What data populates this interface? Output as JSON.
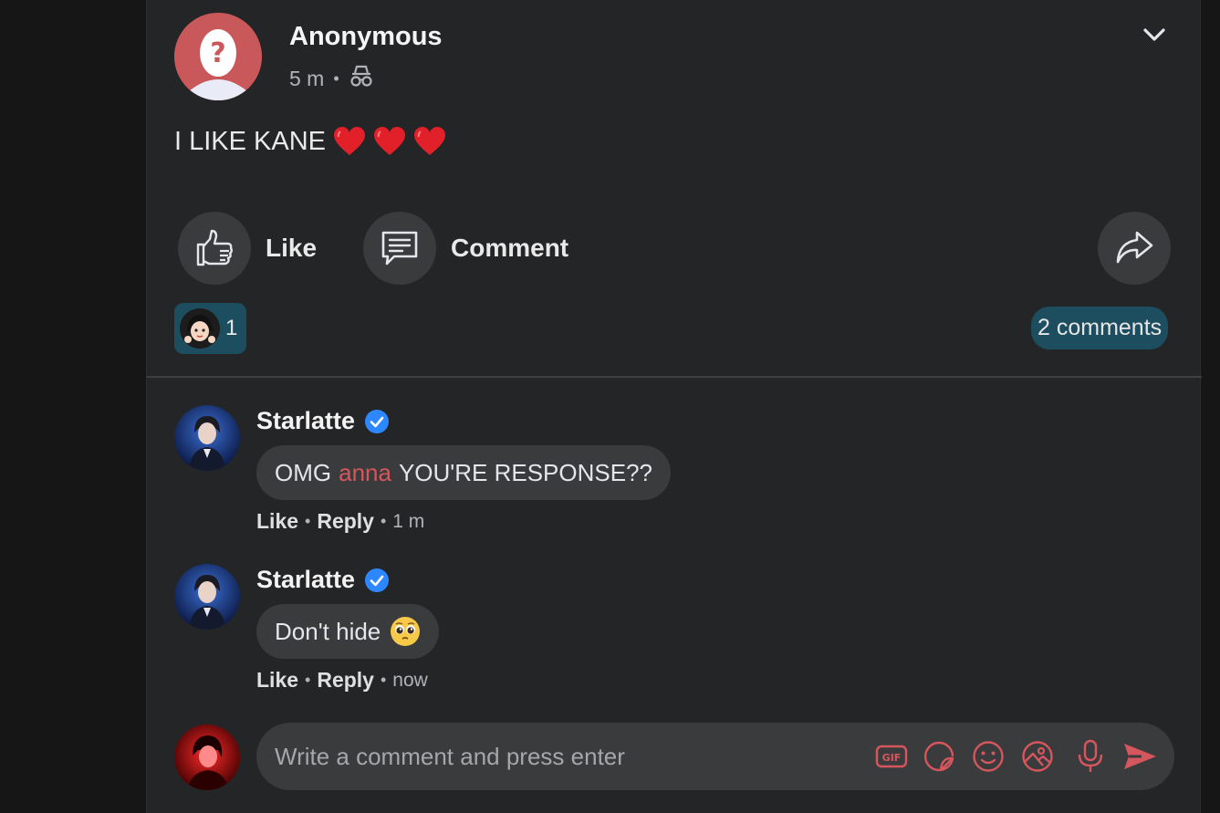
{
  "post": {
    "author": "Anonymous",
    "time": "5 m",
    "text": "I LIKE KANE",
    "text_emoji": "heart x3"
  },
  "actions": {
    "like_label": "Like",
    "comment_label": "Comment"
  },
  "reactions": {
    "count": "1"
  },
  "comments_summary": "2 comments",
  "comments": [
    {
      "name": "Starlatte",
      "text_before": "OMG",
      "mention": "anna",
      "text_after": "YOU'RE RESPONSE??",
      "like": "Like",
      "reply": "Reply",
      "time": "1 m"
    },
    {
      "name": "Starlatte",
      "text": "Don't hide",
      "like": "Like",
      "reply": "Reply",
      "time": "now"
    }
  ],
  "composer": {
    "placeholder": "Write a comment and press enter",
    "gif_label": "GIF"
  },
  "colors": {
    "accent": "#d6565d",
    "badge_bg": "#1d4e60",
    "verified": "#2d88ff",
    "card_bg": "#242526"
  },
  "icons": [
    "chevron-down-icon",
    "incognito-icon",
    "heart-icon",
    "thumbs-up-icon",
    "comment-icon",
    "share-icon",
    "verified-icon",
    "gif-icon",
    "sticker-icon",
    "smile-icon",
    "image-icon",
    "microphone-icon",
    "send-icon"
  ]
}
